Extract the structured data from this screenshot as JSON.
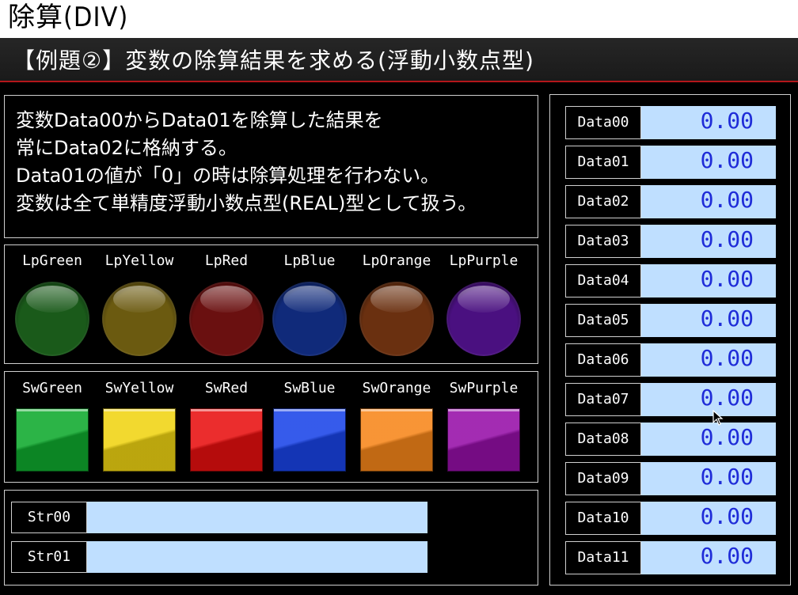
{
  "title": "除算(DIV)",
  "subtitle": "【例題②】変数の除算結果を求める(浮動小数点型)",
  "description": [
    "変数Data00からData01を除算した結果を",
    "常にData02に格納する。",
    "Data01の値が「0」の時は除算処理を行わない。",
    "変数は全て単精度浮動小数点型(REAL)型として扱う。"
  ],
  "lamps": [
    {
      "label": "LpGreen",
      "color": "#1a5a1a"
    },
    {
      "label": "LpYellow",
      "color": "#6b5a10"
    },
    {
      "label": "LpRed",
      "color": "#6a1010"
    },
    {
      "label": "LpBlue",
      "color": "#102a7a"
    },
    {
      "label": "LpOrange",
      "color": "#6a3010"
    },
    {
      "label": "LpPurple",
      "color": "#4a1080"
    }
  ],
  "switches": [
    {
      "label": "SwGreen",
      "color": "#0faa2e"
    },
    {
      "label": "SwYellow",
      "color": "#f0d412"
    },
    {
      "label": "SwRed",
      "color": "#e81010"
    },
    {
      "label": "SwBlue",
      "color": "#1a44e8"
    },
    {
      "label": "SwOrange",
      "color": "#f7861a"
    },
    {
      "label": "SwPurple",
      "color": "#960fa8"
    }
  ],
  "strings": [
    {
      "label": "Str00",
      "value": ""
    },
    {
      "label": "Str01",
      "value": ""
    }
  ],
  "data": [
    {
      "label": "Data00",
      "value": "0.00"
    },
    {
      "label": "Data01",
      "value": "0.00"
    },
    {
      "label": "Data02",
      "value": "0.00"
    },
    {
      "label": "Data03",
      "value": "0.00"
    },
    {
      "label": "Data04",
      "value": "0.00"
    },
    {
      "label": "Data05",
      "value": "0.00"
    },
    {
      "label": "Data06",
      "value": "0.00"
    },
    {
      "label": "Data07",
      "value": "0.00"
    },
    {
      "label": "Data08",
      "value": "0.00"
    },
    {
      "label": "Data09",
      "value": "0.00"
    },
    {
      "label": "Data10",
      "value": "0.00"
    },
    {
      "label": "Data11",
      "value": "0.00"
    }
  ]
}
